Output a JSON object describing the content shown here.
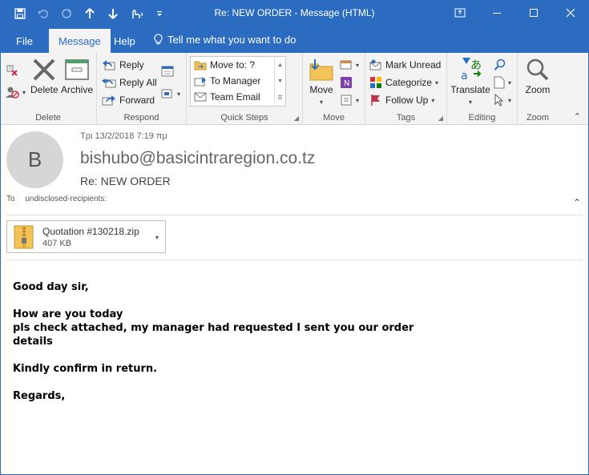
{
  "window": {
    "title": "Re: NEW ORDER  -  Message (HTML)"
  },
  "qat": {
    "icons": [
      "save-icon",
      "undo-icon",
      "redo-icon",
      "arrow-up-icon",
      "arrow-down-icon",
      "touch-mode-icon",
      "customize-icon"
    ]
  },
  "tabs": [
    {
      "label": "File"
    },
    {
      "label": "Message"
    },
    {
      "label": "Help"
    }
  ],
  "tell_me": "Tell me what you want to do",
  "ribbon": {
    "delete_group": {
      "label": "Delete",
      "delete": "Delete",
      "archive": "Archive"
    },
    "respond_group": {
      "label": "Respond",
      "reply": "Reply",
      "reply_all": "Reply All",
      "forward": "Forward"
    },
    "quick_steps": {
      "label": "Quick Steps",
      "items": [
        "Move to: ?",
        "To Manager",
        "Team Email"
      ]
    },
    "move_group": {
      "label": "Move",
      "move": "Move"
    },
    "tags_group": {
      "label": "Tags",
      "mark_unread": "Mark Unread",
      "categorize": "Categorize",
      "follow_up": "Follow Up"
    },
    "editing_group": {
      "label": "Editing",
      "translate": "Translate"
    },
    "zoom_group": {
      "label": "Zoom",
      "zoom": "Zoom"
    }
  },
  "message": {
    "avatar_letter": "B",
    "date": "Τρι 13/2/2018 7:19 πμ",
    "sender": "bishubo@basicintraregion.co.tz",
    "subject": "Re: NEW ORDER",
    "to_label": "To",
    "to_value": "undisclosed-recipients:",
    "attachment": {
      "name": "Quotation #130218.zip",
      "size": "407 KB"
    },
    "body": {
      "line1": "Good day sir,",
      "line2": "How are you today",
      "line3": "pls check attached, my manager had requested I sent you our order",
      "line4": "details",
      "line5": "Kindly confirm in return.",
      "line6": "Regards,"
    }
  },
  "colors": {
    "accent": "#2b6cc0",
    "ribbon_bg": "#f3f3f3"
  }
}
